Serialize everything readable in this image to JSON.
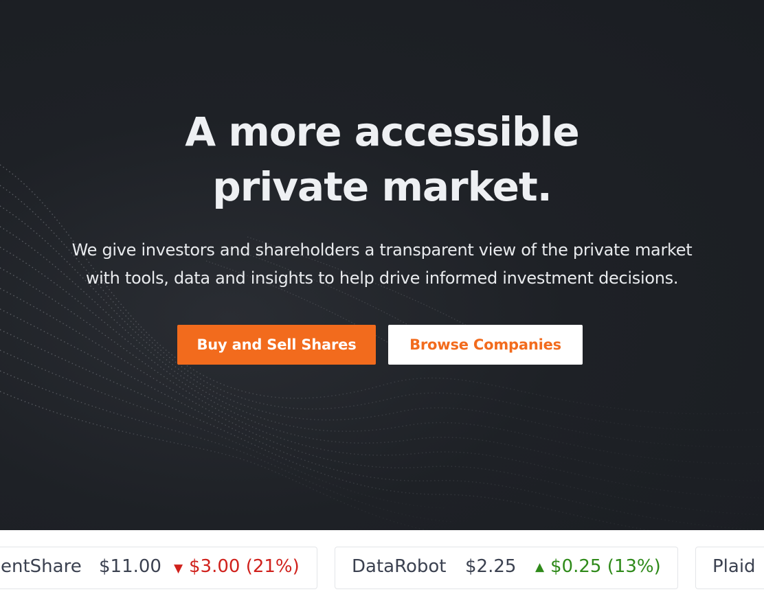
{
  "hero": {
    "headline_line1": "A more accessible",
    "headline_line2": "private market.",
    "subtitle_line1": "We give investors and shareholders a transparent view of the private market",
    "subtitle_line2": "with tools, data and insights to help drive informed investment decisions.",
    "primary_button": "Buy and Sell Shares",
    "secondary_button": "Browse Companies"
  },
  "ticker": {
    "items": [
      {
        "name": "entShare",
        "price": "$11.00",
        "direction": "down",
        "arrow": "▼",
        "change": "$3.00 (21%)"
      },
      {
        "name": "DataRobot",
        "price": "$2.25",
        "direction": "up",
        "arrow": "▲",
        "change": "$0.25 (13%)"
      },
      {
        "name": "Plaid",
        "price": "",
        "direction": "",
        "arrow": "",
        "change": ""
      }
    ]
  },
  "colors": {
    "accent": "#f26b1d",
    "hero_background": "#1e2126",
    "down": "#d0211c",
    "up": "#2f8a1a"
  }
}
